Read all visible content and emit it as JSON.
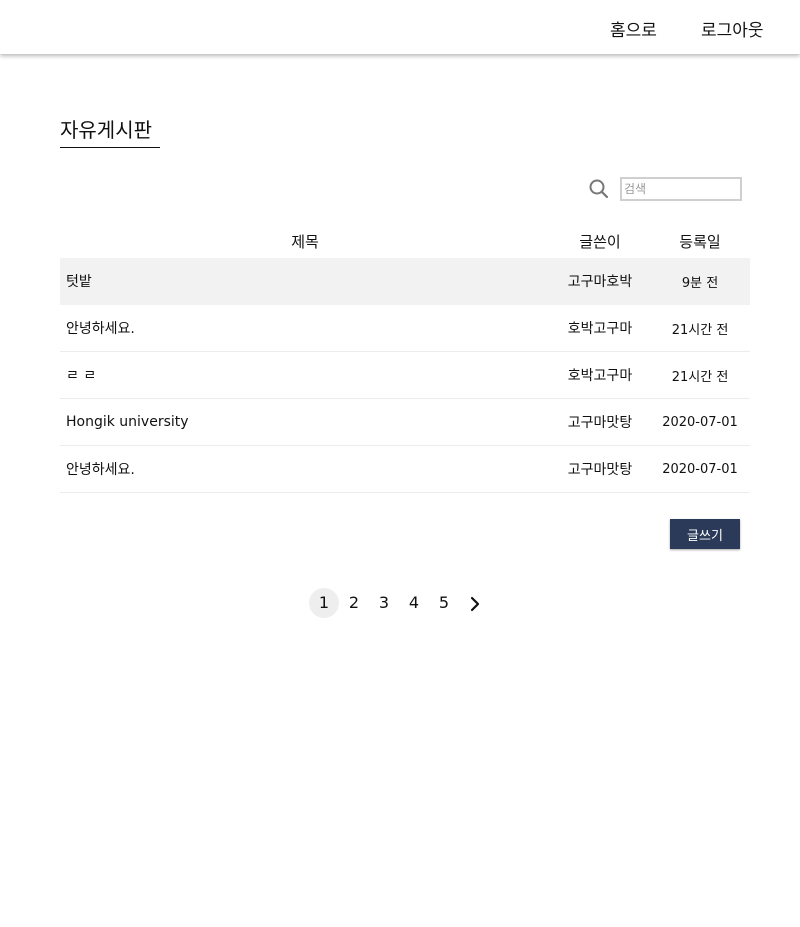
{
  "nav": {
    "home_label": "홈으로",
    "logout_label": "로그아웃"
  },
  "board": {
    "title": "자유게시판"
  },
  "search": {
    "placeholder": "검색",
    "value": ""
  },
  "table": {
    "headers": {
      "title": "제목",
      "author": "글쓴이",
      "date": "등록일"
    },
    "rows": [
      {
        "title": "텃밭",
        "author": "고구마호박",
        "date": "9분 전"
      },
      {
        "title": "안녕하세요.",
        "author": "호박고구마",
        "date": "21시간 전"
      },
      {
        "title": "ㄹ ㄹ",
        "author": "호박고구마",
        "date": "21시간 전"
      },
      {
        "title": "Hongik university",
        "author": "고구마맛탕",
        "date": "2020-07-01"
      },
      {
        "title": "안녕하세요.",
        "author": "고구마맛탕",
        "date": "2020-07-01"
      }
    ]
  },
  "actions": {
    "write_label": "글쓰기"
  },
  "pagination": {
    "pages": [
      "1",
      "2",
      "3",
      "4",
      "5"
    ],
    "current": "1",
    "next_icon": "chevron-right-icon"
  },
  "colors": {
    "accent": "#2b3a58",
    "row_highlight": "#f2f2f2"
  }
}
